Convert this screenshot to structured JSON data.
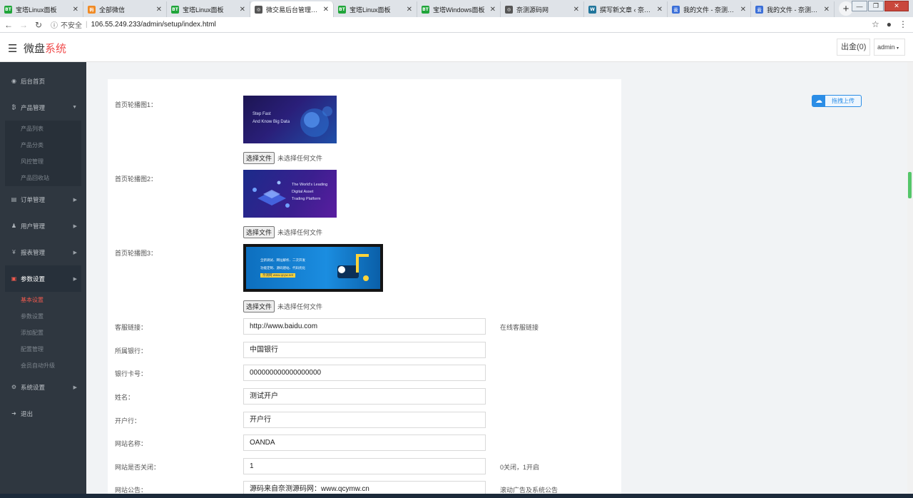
{
  "browser": {
    "tabs": [
      {
        "label": "宝塔Linux面板",
        "favicon": "BT",
        "color": "#20a53a",
        "active": false
      },
      {
        "label": "全部微信",
        "favicon": "码",
        "color": "#f08a24",
        "active": false
      },
      {
        "label": "宝塔Linux面板",
        "favicon": "BT",
        "color": "#20a53a",
        "active": false
      },
      {
        "label": "微交易后台管理系统",
        "favicon": "◎",
        "color": "#555555",
        "active": true
      },
      {
        "label": "宝塔Linux面板",
        "favicon": "BT",
        "color": "#20a53a",
        "active": false
      },
      {
        "label": "宝塔Windows面板",
        "favicon": "BT",
        "color": "#20a53a",
        "active": false
      },
      {
        "label": "奈测源码网",
        "favicon": "◎",
        "color": "#555555",
        "active": false
      },
      {
        "label": "撰写新文章 ‹ 奈测源",
        "favicon": "W",
        "color": "#21759b",
        "active": false
      },
      {
        "label": "我的文件 - 奈测源码",
        "favicon": "云",
        "color": "#3b6fd8",
        "active": false
      },
      {
        "label": "我的文件 - 奈测源码",
        "favicon": "云",
        "color": "#3b6fd8",
        "active": false
      }
    ],
    "insecure_label": "不安全",
    "url": "106.55.249.233/admin/setup/index.html"
  },
  "header": {
    "brand_main": "微盘",
    "brand_accent": "系统",
    "withdraw_label": "出金(0)",
    "user_label": "admin"
  },
  "sidebar": {
    "items": [
      {
        "label": "后台首页",
        "icon": "dashboard-icon"
      },
      {
        "label": "产品管理",
        "icon": "bitcoin-icon"
      },
      {
        "label": "订单管理",
        "icon": "orders-icon"
      },
      {
        "label": "用户管理",
        "icon": "user-icon"
      },
      {
        "label": "报表管理",
        "icon": "yen-icon"
      },
      {
        "label": "参数设置",
        "icon": "settings-doc-icon"
      },
      {
        "label": "系统设置",
        "icon": "gears-icon"
      },
      {
        "label": "退出",
        "icon": "logout-icon"
      }
    ],
    "product_sub": [
      "产品列表",
      "产品分类",
      "风控管理",
      "产品回收站"
    ],
    "params_sub": [
      "基本设置",
      "参数设置",
      "添加配置",
      "配置管理",
      "会员自动升级"
    ]
  },
  "form": {
    "banner1_label": "首页轮播图1：",
    "banner2_label": "首页轮播图2：",
    "banner3_label": "首页轮播图3：",
    "banner1_text": [
      "Step Fast",
      "And Know Big Data"
    ],
    "banner2_text": [
      "The World's Leading",
      "Digital Asset",
      "Trading Platform"
    ],
    "banner3_text": [
      "全新调试、网址解析、二次开发",
      "功能定制、源码建站、代码优化",
      "奈测网 www.qcyw.net"
    ],
    "file_button": "选择文件",
    "file_none": "未选择任何文件",
    "fields": [
      {
        "label": "客服链接：",
        "value": "http://www.baidu.com",
        "hint": "在线客服链接"
      },
      {
        "label": "所属银行：",
        "value": "中国银行",
        "hint": ""
      },
      {
        "label": "银行卡号：",
        "value": "000000000000000000",
        "hint": ""
      },
      {
        "label": "姓名：",
        "value": "测试开户",
        "hint": ""
      },
      {
        "label": "开户行：",
        "value": "开户行",
        "hint": ""
      },
      {
        "label": "网站名称：",
        "value": "OANDA",
        "hint": ""
      },
      {
        "label": "网站是否关闭：",
        "value": "1",
        "hint": "0关闭，1开启"
      },
      {
        "label": "网站公告：",
        "value": "源码来自奈测源码网：www.qcymw.cn",
        "hint": "滚动广告及系统公告"
      }
    ]
  },
  "widget": {
    "upload_label": "拖拽上传"
  }
}
